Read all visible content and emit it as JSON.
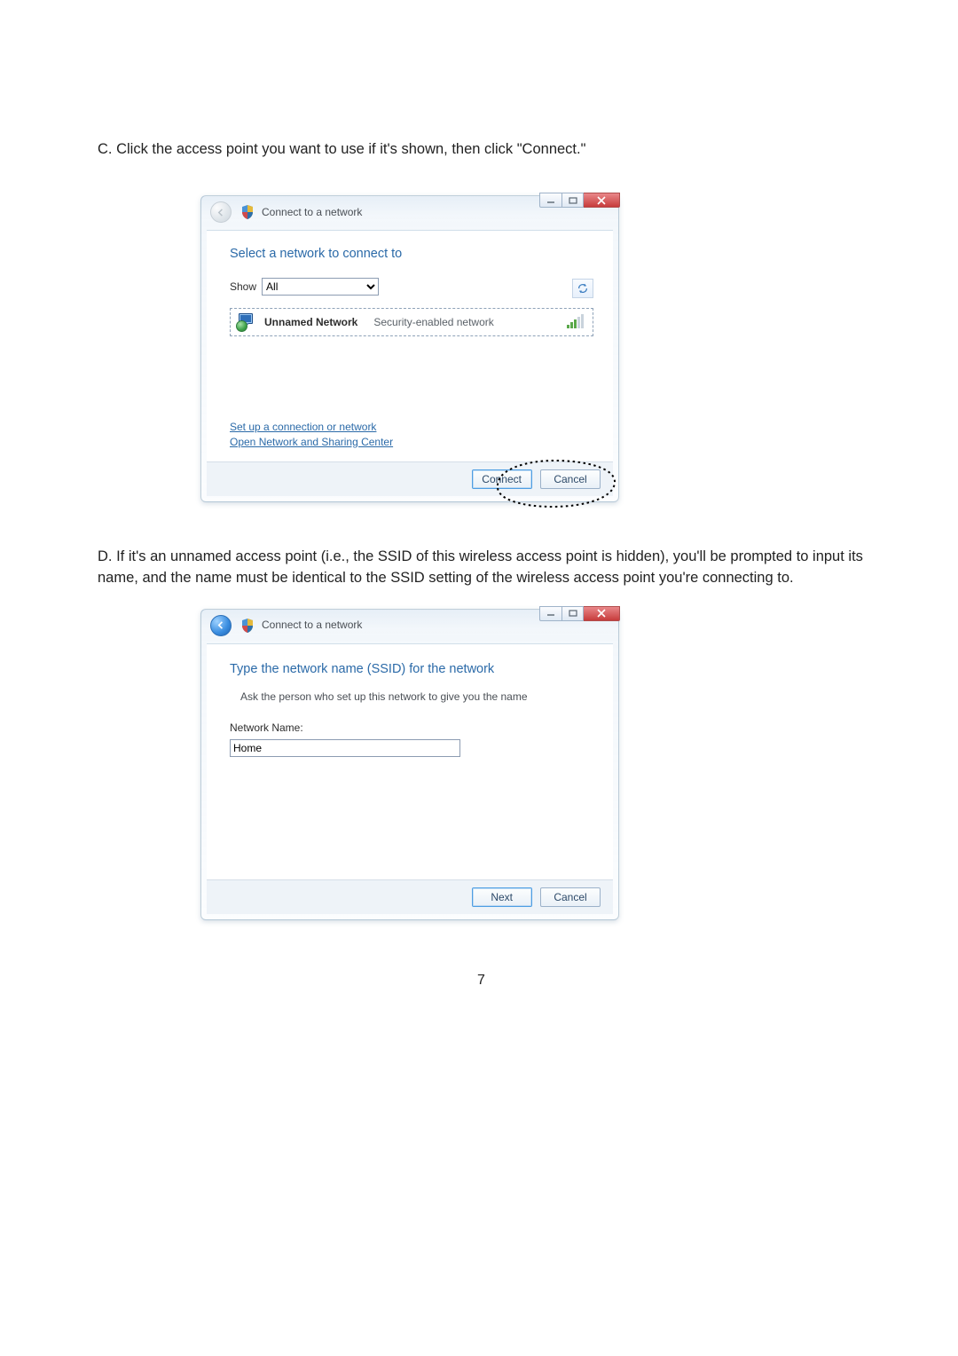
{
  "doc": {
    "step_c": "C. Click the access point you want to use if it's shown, then click \"Connect.\"",
    "step_d_lead": "D. ",
    "step_d_body": "If it's an unnamed access point (i.e., the SSID of this wireless access point is hidden), you'll be prompted to input its name, and the name must be identical to the SSID setting of the wireless access point you're connecting to.",
    "page_number": "7"
  },
  "win1": {
    "title": "Connect to a network",
    "heading": "Select a network to connect to",
    "show_label": "Show",
    "show_value": "All",
    "network": {
      "name": "Unnamed Network",
      "type": "Security-enabled network"
    },
    "links": {
      "setup": "Set up a connection or network",
      "sharing": "Open Network and Sharing Center"
    },
    "buttons": {
      "connect": "Connect",
      "cancel": "Cancel"
    }
  },
  "win2": {
    "title": "Connect to a network",
    "heading": "Type the network name (SSID) for the network",
    "sub": "Ask the person who set up this network to give you the name",
    "field_label": "Network Name:",
    "field_value": "Home",
    "buttons": {
      "next": "Next",
      "cancel": "Cancel"
    }
  }
}
